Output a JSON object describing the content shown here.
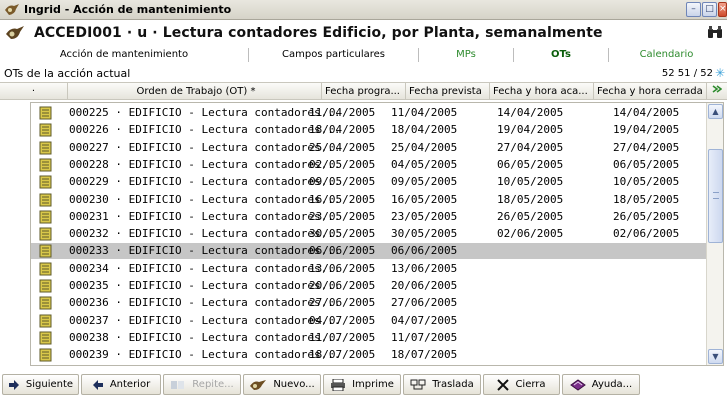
{
  "window": {
    "title": "Ingrid - Acción de mantenimiento",
    "buttons": [
      "minimize",
      "maximize",
      "close"
    ]
  },
  "heading": {
    "text": "ACCEDI001 · u · Lectura contadores Edificio, por Planta, semanalmente"
  },
  "tabs": [
    {
      "label": "Acción de mantenimiento",
      "active": false
    },
    {
      "label": "Campos particulares",
      "active": false
    },
    {
      "label": "MPs",
      "active": false
    },
    {
      "label": "OTs",
      "active": true
    },
    {
      "label": "Calendario",
      "active": false
    }
  ],
  "subheader": {
    "label": "OTs de la acción actual",
    "count": "52 51 / 52"
  },
  "columns": {
    "c0": "·",
    "c1": "Orden de Trabajo (OT) *",
    "c2": "Fecha progra...",
    "c3": "Fecha prevista",
    "c4": "Fecha y hora aca...",
    "c5": "Fecha y hora cerrada"
  },
  "rows": [
    {
      "ot": "000225 · EDIFICIO - Lectura contadores...",
      "d1": "11/04/2005",
      "d2": "11/04/2005",
      "d3": "14/04/2005",
      "d4": "14/04/2005",
      "selected": false
    },
    {
      "ot": "000226 · EDIFICIO - Lectura contadores...",
      "d1": "18/04/2005",
      "d2": "18/04/2005",
      "d3": "19/04/2005",
      "d4": "19/04/2005",
      "selected": false
    },
    {
      "ot": "000227 · EDIFICIO - Lectura contadores...",
      "d1": "25/04/2005",
      "d2": "25/04/2005",
      "d3": "27/04/2005",
      "d4": "27/04/2005",
      "selected": false
    },
    {
      "ot": "000228 · EDIFICIO - Lectura contadores...",
      "d1": "02/05/2005",
      "d2": "04/05/2005",
      "d3": "06/05/2005",
      "d4": "06/05/2005",
      "selected": false
    },
    {
      "ot": "000229 · EDIFICIO - Lectura contadores...",
      "d1": "09/05/2005",
      "d2": "09/05/2005",
      "d3": "10/05/2005",
      "d4": "10/05/2005",
      "selected": false
    },
    {
      "ot": "000230 · EDIFICIO - Lectura contadores...",
      "d1": "16/05/2005",
      "d2": "16/05/2005",
      "d3": "18/05/2005",
      "d4": "18/05/2005",
      "selected": false
    },
    {
      "ot": "000231 · EDIFICIO - Lectura contadores...",
      "d1": "23/05/2005",
      "d2": "23/05/2005",
      "d3": "26/05/2005",
      "d4": "26/05/2005",
      "selected": false
    },
    {
      "ot": "000232 · EDIFICIO - Lectura contadores...",
      "d1": "30/05/2005",
      "d2": "30/05/2005",
      "d3": "02/06/2005",
      "d4": "02/06/2005",
      "selected": false
    },
    {
      "ot": "000233 · EDIFICIO - Lectura contadores...",
      "d1": "06/06/2005",
      "d2": "06/06/2005",
      "d3": "",
      "d4": "",
      "selected": true
    },
    {
      "ot": "000234 · EDIFICIO - Lectura contadores...",
      "d1": "13/06/2005",
      "d2": "13/06/2005",
      "d3": "",
      "d4": "",
      "selected": false
    },
    {
      "ot": "000235 · EDIFICIO - Lectura contadores...",
      "d1": "20/06/2005",
      "d2": "20/06/2005",
      "d3": "",
      "d4": "",
      "selected": false
    },
    {
      "ot": "000236 · EDIFICIO - Lectura contadores...",
      "d1": "27/06/2005",
      "d2": "27/06/2005",
      "d3": "",
      "d4": "",
      "selected": false
    },
    {
      "ot": "000237 · EDIFICIO - Lectura contadores...",
      "d1": "04/07/2005",
      "d2": "04/07/2005",
      "d3": "",
      "d4": "",
      "selected": false
    },
    {
      "ot": "000238 · EDIFICIO - Lectura contadores...",
      "d1": "11/07/2005",
      "d2": "11/07/2005",
      "d3": "",
      "d4": "",
      "selected": false
    },
    {
      "ot": "000239 · EDIFICIO - Lectura contadores...",
      "d1": "18/07/2005",
      "d2": "18/07/2005",
      "d3": "",
      "d4": "",
      "selected": false
    }
  ],
  "toolbar": [
    {
      "label": "Siguiente",
      "icon": "arrow-right-icon",
      "enabled": true
    },
    {
      "label": "Anterior",
      "icon": "arrow-left-icon",
      "enabled": true
    },
    {
      "label": "Repite...",
      "icon": "repeat-icon",
      "enabled": false
    },
    {
      "label": "Nuevo...",
      "icon": "new-icon",
      "enabled": true
    },
    {
      "label": "Imprime",
      "icon": "printer-icon",
      "enabled": true
    },
    {
      "label": "Traslada",
      "icon": "transfer-icon",
      "enabled": true
    },
    {
      "label": "Cierra",
      "icon": "close-x-icon",
      "enabled": true
    },
    {
      "label": "Ayuda...",
      "icon": "help-book-icon",
      "enabled": true
    }
  ],
  "colors": {
    "tab_green": "#2e8b2e",
    "selection": "#c6c6c6",
    "ot_icon": "#d9c84a"
  }
}
